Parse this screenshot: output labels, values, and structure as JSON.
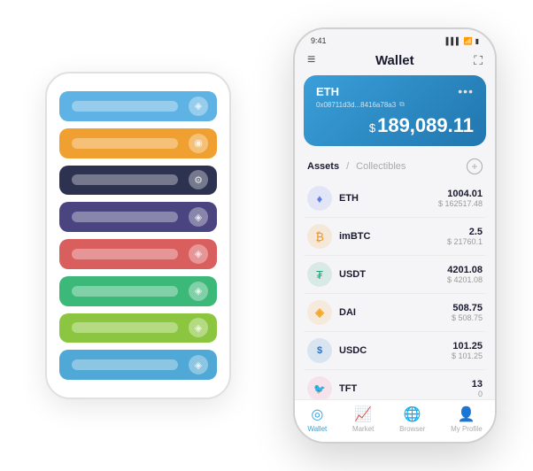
{
  "scene": {
    "back_phone": {
      "cards": [
        {
          "color": "card-blue",
          "icon": "◈"
        },
        {
          "color": "card-orange",
          "icon": "◉"
        },
        {
          "color": "card-dark",
          "icon": "⚙"
        },
        {
          "color": "card-purple",
          "icon": "◈"
        },
        {
          "color": "card-red",
          "icon": "◈"
        },
        {
          "color": "card-green",
          "icon": "◈"
        },
        {
          "color": "card-lime",
          "icon": "◈"
        },
        {
          "color": "card-bluelight",
          "icon": "◈"
        }
      ]
    },
    "front_phone": {
      "status_bar": {
        "time": "9:41",
        "signal": "▌▌▌",
        "wifi": "WiFi",
        "battery": "🔋"
      },
      "header": {
        "menu_icon": "≡",
        "title": "Wallet",
        "expand_icon": "⛶"
      },
      "eth_card": {
        "name": "ETH",
        "dots": "•••",
        "address": "0x08711d3d...8416a78a3",
        "copy_icon": "⧉",
        "balance_prefix": "$",
        "balance": "189,089.11"
      },
      "assets_section": {
        "tab_active": "Assets",
        "slash": "/",
        "tab_inactive": "Collectibles",
        "add_icon": "+"
      },
      "assets": [
        {
          "symbol": "ETH",
          "icon_char": "♦",
          "icon_class": "icon-eth",
          "amount": "1004.01",
          "usd": "$ 162517.48"
        },
        {
          "symbol": "imBTC",
          "icon_char": "₿",
          "icon_class": "icon-imbtc",
          "amount": "2.5",
          "usd": "$ 21760.1"
        },
        {
          "symbol": "USDT",
          "icon_char": "₮",
          "icon_class": "icon-usdt",
          "amount": "4201.08",
          "usd": "$ 4201.08"
        },
        {
          "symbol": "DAI",
          "icon_char": "◈",
          "icon_class": "icon-dai",
          "amount": "508.75",
          "usd": "$ 508.75"
        },
        {
          "symbol": "USDC",
          "icon_char": "$",
          "icon_class": "icon-usdc",
          "amount": "101.25",
          "usd": "$ 101.25"
        },
        {
          "symbol": "TFT",
          "icon_char": "🐦",
          "icon_class": "icon-tft",
          "amount": "13",
          "usd": "0"
        }
      ],
      "bottom_nav": [
        {
          "label": "Wallet",
          "icon": "◎",
          "active": true
        },
        {
          "label": "Market",
          "icon": "📊",
          "active": false
        },
        {
          "label": "Browser",
          "icon": "🌐",
          "active": false
        },
        {
          "label": "My Profile",
          "icon": "👤",
          "active": false
        }
      ]
    }
  }
}
